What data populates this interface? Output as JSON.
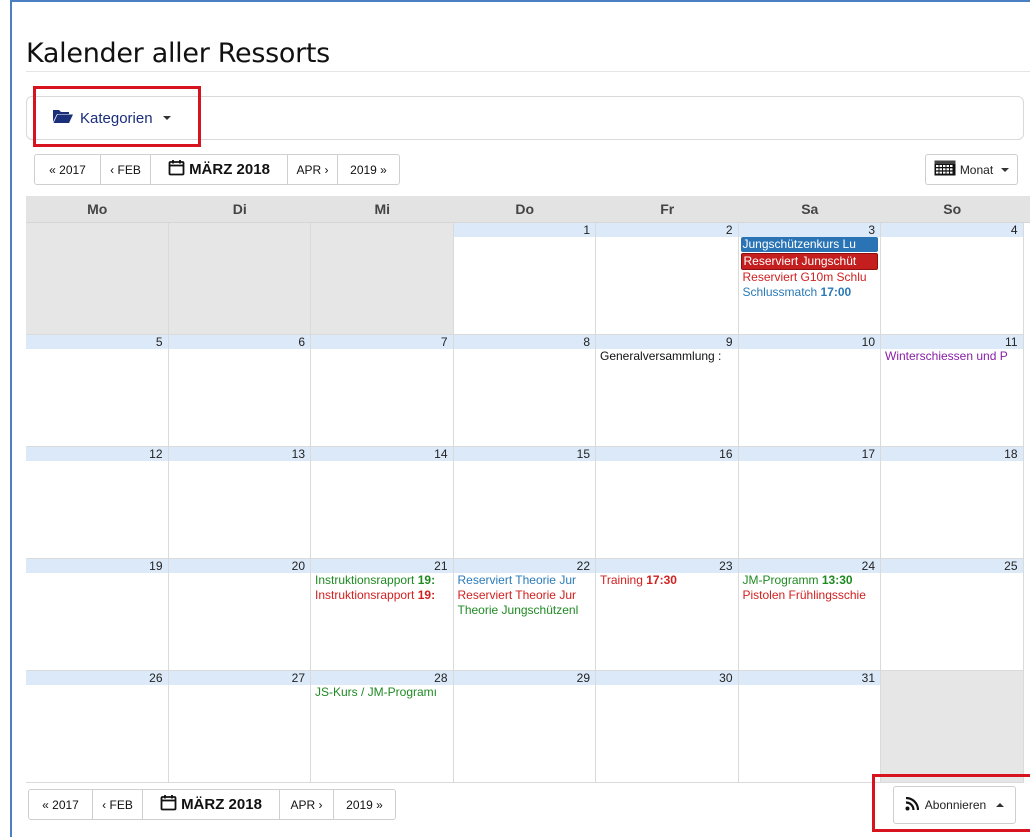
{
  "page": {
    "title": "Kalender aller Ressorts"
  },
  "categories": {
    "label": "Kategorien"
  },
  "nav": {
    "prev_year": "« 2017",
    "prev_month": "‹ FEB",
    "current": "MÄRZ 2018",
    "next_month": "APR ›",
    "next_year": "2019 »"
  },
  "view": {
    "label": "Monat"
  },
  "subscribe": {
    "label": "Abonnieren"
  },
  "weekdays": [
    "Mo",
    "Di",
    "Mi",
    "Do",
    "Fr",
    "Sa",
    "So"
  ],
  "weeks": [
    [
      {
        "num": "",
        "empty": true,
        "events": []
      },
      {
        "num": "",
        "empty": true,
        "events": []
      },
      {
        "num": "",
        "empty": true,
        "events": []
      },
      {
        "num": "1",
        "events": []
      },
      {
        "num": "2",
        "events": []
      },
      {
        "num": "3",
        "events": [
          {
            "style": "blue-bg",
            "text": "Jungschützenkurs Lu"
          },
          {
            "style": "red-bg",
            "text": "Reserviert Jungschüt"
          },
          {
            "style": "red",
            "text": "Reserviert G10m Schlu"
          },
          {
            "style": "blue",
            "text": "Schlussmatch ",
            "time": "17:00",
            "time_color": "t-blue"
          }
        ]
      },
      {
        "num": "4",
        "events": []
      }
    ],
    [
      {
        "num": "5",
        "events": []
      },
      {
        "num": "6",
        "events": []
      },
      {
        "num": "7",
        "events": []
      },
      {
        "num": "8",
        "events": []
      },
      {
        "num": "9",
        "events": [
          {
            "style": "black",
            "text": "Generalversammlung :"
          }
        ]
      },
      {
        "num": "10",
        "events": []
      },
      {
        "num": "11",
        "events": [
          {
            "style": "purple",
            "text": "Winterschiessen und P"
          }
        ]
      }
    ],
    [
      {
        "num": "12",
        "events": []
      },
      {
        "num": "13",
        "events": []
      },
      {
        "num": "14",
        "events": []
      },
      {
        "num": "15",
        "events": []
      },
      {
        "num": "16",
        "events": []
      },
      {
        "num": "17",
        "events": []
      },
      {
        "num": "18",
        "events": []
      }
    ],
    [
      {
        "num": "19",
        "events": []
      },
      {
        "num": "20",
        "events": []
      },
      {
        "num": "21",
        "events": [
          {
            "style": "green",
            "text": "Instruktionsrapport ",
            "time": "19:",
            "time_color": "t-green"
          },
          {
            "style": "red",
            "text": "Instruktionsrapport ",
            "time": "19:",
            "time_color": "t-red"
          }
        ]
      },
      {
        "num": "22",
        "events": [
          {
            "style": "blue",
            "text": "Reserviert Theorie Jur"
          },
          {
            "style": "red",
            "text": "Reserviert Theorie Jur"
          },
          {
            "style": "green",
            "text": "Theorie Jungschützenl"
          }
        ]
      },
      {
        "num": "23",
        "events": [
          {
            "style": "red",
            "text": "Training ",
            "time": "17:30",
            "time_color": "t-red"
          }
        ]
      },
      {
        "num": "24",
        "events": [
          {
            "style": "green",
            "text": "JM-Programm ",
            "time": "13:30",
            "time_color": "t-green"
          },
          {
            "style": "red",
            "text": "Pistolen Frühlingsschie"
          }
        ]
      },
      {
        "num": "25",
        "events": []
      }
    ],
    [
      {
        "num": "26",
        "events": []
      },
      {
        "num": "27",
        "events": []
      },
      {
        "num": "28",
        "events": [
          {
            "style": "green",
            "text": "JS-Kurs / JM-Programı"
          }
        ]
      },
      {
        "num": "29",
        "events": []
      },
      {
        "num": "30",
        "events": []
      },
      {
        "num": "31",
        "events": []
      },
      {
        "num": "",
        "empty": true,
        "events": []
      }
    ]
  ]
}
